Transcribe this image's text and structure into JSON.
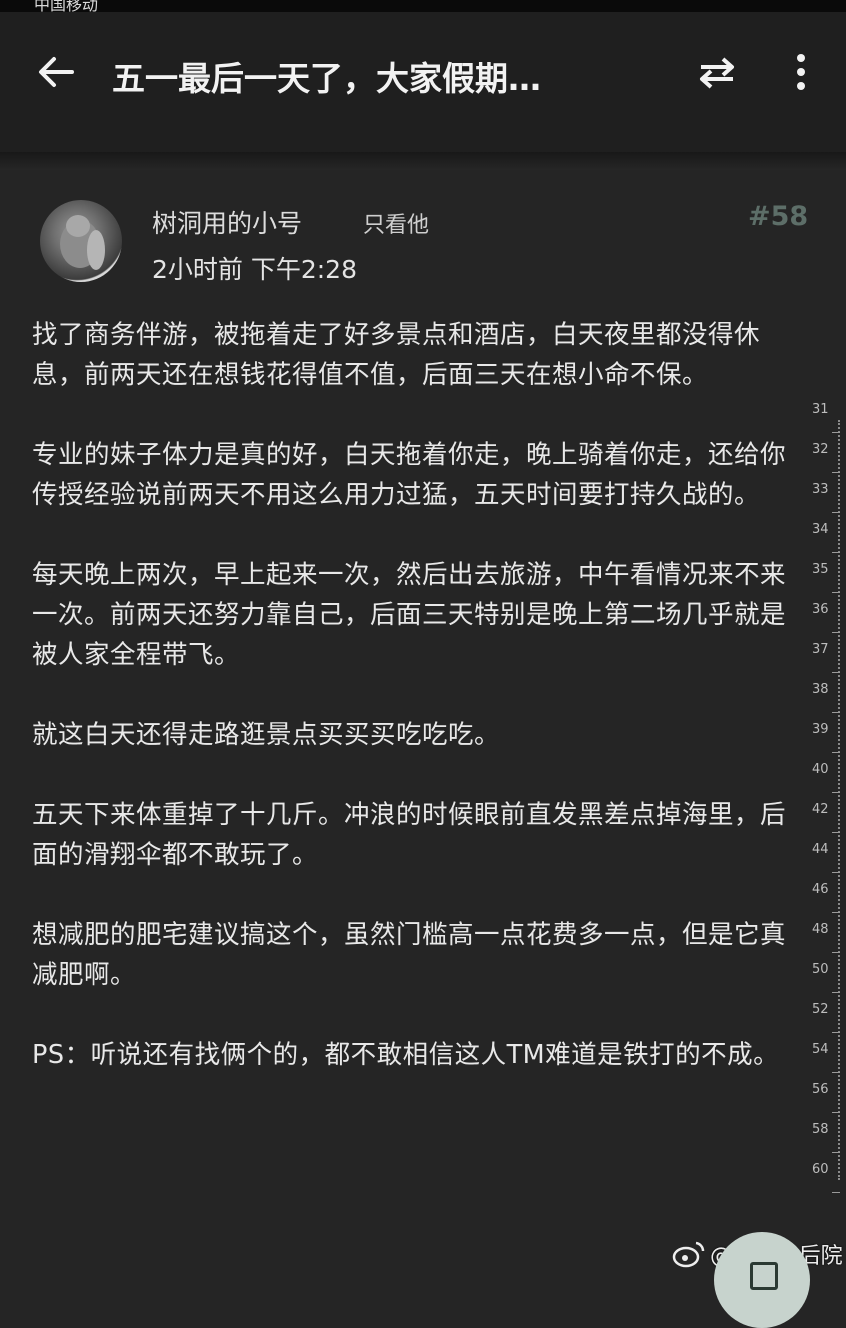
{
  "status_bar": {
    "carrier": "中国移动"
  },
  "header": {
    "title": "五一最后一天了，大家假期…"
  },
  "post": {
    "author": "树洞用的小号",
    "only_him_label": "只看他",
    "floor": "#58",
    "time": "2小时前 下午2:28",
    "paragraphs": [
      "找了商务伴游，被拖着走了好多景点和酒店，白天夜里都没得休息，前两天还在想钱花得值不值，后面三天在想小命不保。",
      "专业的妹子体力是真的好，白天拖着你走，晚上骑着你走，还给你传授经验说前两天不用这么用力过猛，五天时间要打持久战的。",
      "每天晚上两次，早上起来一次，然后出去旅游，中午看情况来不来一次。前两天还努力靠自己，后面三天特别是晚上第二场几乎就是被人家全程带飞。",
      "就这白天还得走路逛景点买买买吃吃吃。",
      "五天下来体重掉了十几斤。冲浪的时候眼前直发黑差点掉海里，后面的滑翔伞都不敢玩了。",
      "想减肥的肥宅建议搞这个，虽然门槛高一点花费多一点，但是它真减肥啊。",
      "PS：听说还有找俩个的，都不敢相信这人TM难道是铁打的不成。"
    ]
  },
  "scroll_gutter": {
    "numbers": [
      "31",
      "32",
      "33",
      "34",
      "35",
      "36",
      "37",
      "38",
      "39",
      "40",
      "42",
      "44",
      "46",
      "48",
      "50",
      "52",
      "54",
      "56",
      "58",
      "60"
    ]
  },
  "watermark": {
    "text": "@Tom的后院"
  },
  "icons": {
    "back": "back-arrow-icon",
    "swap": "swap-icon",
    "more": "more-vertical-icon",
    "fab": "reply-icon"
  }
}
